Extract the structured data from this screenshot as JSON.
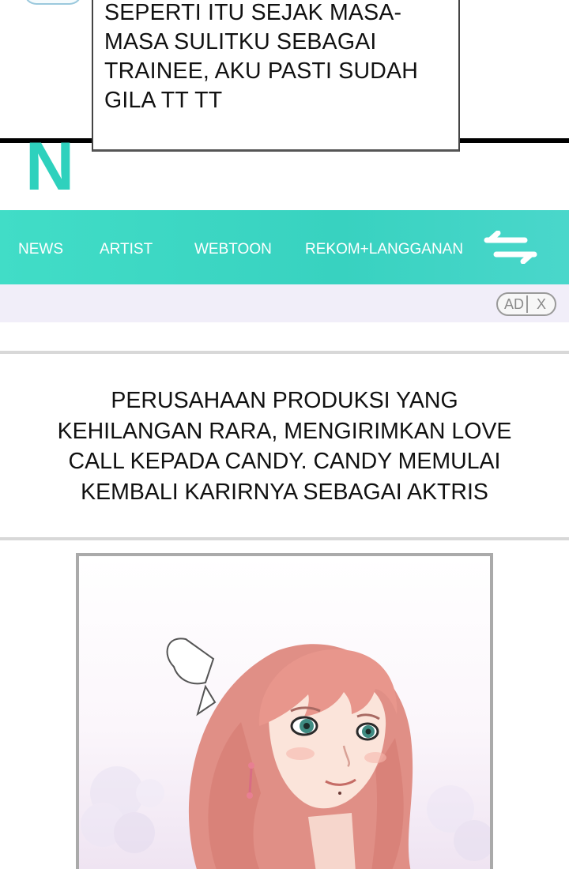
{
  "speech": {
    "lines": [
      "SEPERTI ITU SEJAK MASA-",
      "MASA SULITKU SEBAGAI",
      "TRAINEE, AKU PASTI SUDAH",
      "GILA TT TT"
    ]
  },
  "site": {
    "logo": "N",
    "accent_color": "#3dd8c4"
  },
  "nav": {
    "items": [
      "NEWS",
      "ARTIST",
      "WEBTOON",
      "REKOM+LANGGANAN"
    ],
    "swap_icon": "swap-arrows-icon"
  },
  "ad": {
    "label": "AD",
    "close": "X"
  },
  "caption": {
    "lines": [
      "PERUSAHAAN PRODUKSI YANG",
      "KEHILANGAN RARA, MENGIRIMKAN LOVE",
      "CALL KEPADA CANDY. CANDY MEMULAI",
      "KEMBALI KARIRNYA SEBAGAI AKTRIS"
    ]
  },
  "illustration": {
    "subject": "",
    "hair_color": "#e8968c"
  }
}
